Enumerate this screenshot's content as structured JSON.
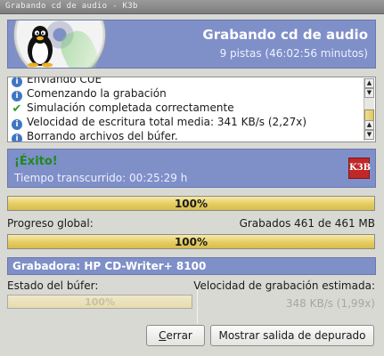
{
  "window": {
    "title": "Grabando cd de audio - K3b"
  },
  "header": {
    "title": "Grabando cd de audio",
    "subtitle": "9 pistas (46:02:56 minutos)"
  },
  "log": {
    "items": [
      {
        "icon": "info-icon",
        "text": "Enviando CUE"
      },
      {
        "icon": "info-icon",
        "text": "Comenzando la grabación"
      },
      {
        "icon": "check-icon",
        "text": "Simulación completada correctamente"
      },
      {
        "icon": "info-icon",
        "text": "Velocidad de escritura total media: 341 KB/s (2,27x)"
      },
      {
        "icon": "info-icon",
        "text": "Borrando archivos del búfer."
      }
    ]
  },
  "status": {
    "title": "¡Éxito!",
    "elapsed": "Tiempo transcurrido: 00:25:29 h",
    "logo_text": "K3B"
  },
  "progress": {
    "track_percent": 100,
    "track_label": "100%",
    "global_label": "Progreso global:",
    "global_info": "Grabados 461 de 461 MB",
    "global_percent": 100,
    "global_bar_label": "100%"
  },
  "writer": {
    "label": "Grabadora: HP CD-Writer+ 8100"
  },
  "buffer": {
    "label": "Estado del búfer:",
    "percent": 100,
    "bar_label": "100%"
  },
  "speed": {
    "label": "Velocidad de grabación estimada:",
    "value": "348 KB/s (1,99x)"
  },
  "buttons": {
    "close_prefix": "",
    "close_mnemonic": "C",
    "close_rest": "errar",
    "debug": "Mostrar salida de depurado"
  },
  "colors": {
    "header_bg": "#7f8fc8",
    "success_text": "#1d8a1d",
    "progress_fill": "#e5cd62"
  }
}
